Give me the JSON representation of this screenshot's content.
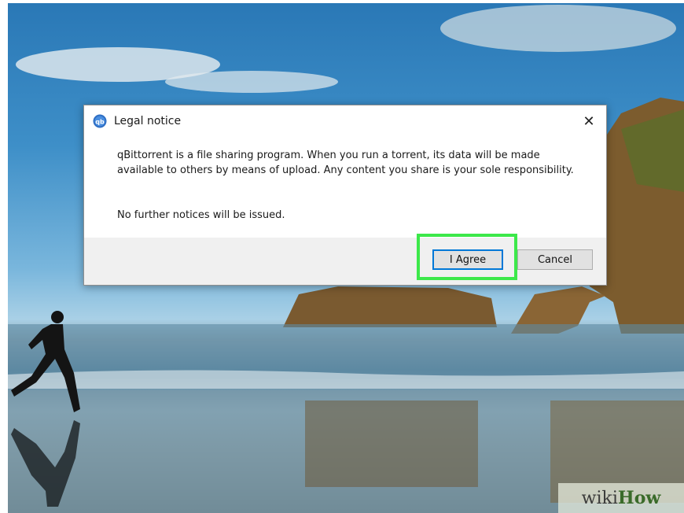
{
  "dialog": {
    "title": "Legal notice",
    "close_glyph": "✕",
    "message": "qBittorrent is a file sharing program. When you run a torrent, its data will be made available to others by means of upload. Any content you share is your sole responsibility.",
    "notice": "No further notices will be issued.",
    "agree_label": "I Agree",
    "cancel_label": "Cancel"
  },
  "watermark": {
    "prefix": "wiki",
    "suffix": "How"
  },
  "icons": {
    "app": "qbittorrent-icon",
    "close": "close-icon"
  },
  "colors": {
    "highlight": "#3ce84a",
    "focus_border": "#0078d7"
  }
}
